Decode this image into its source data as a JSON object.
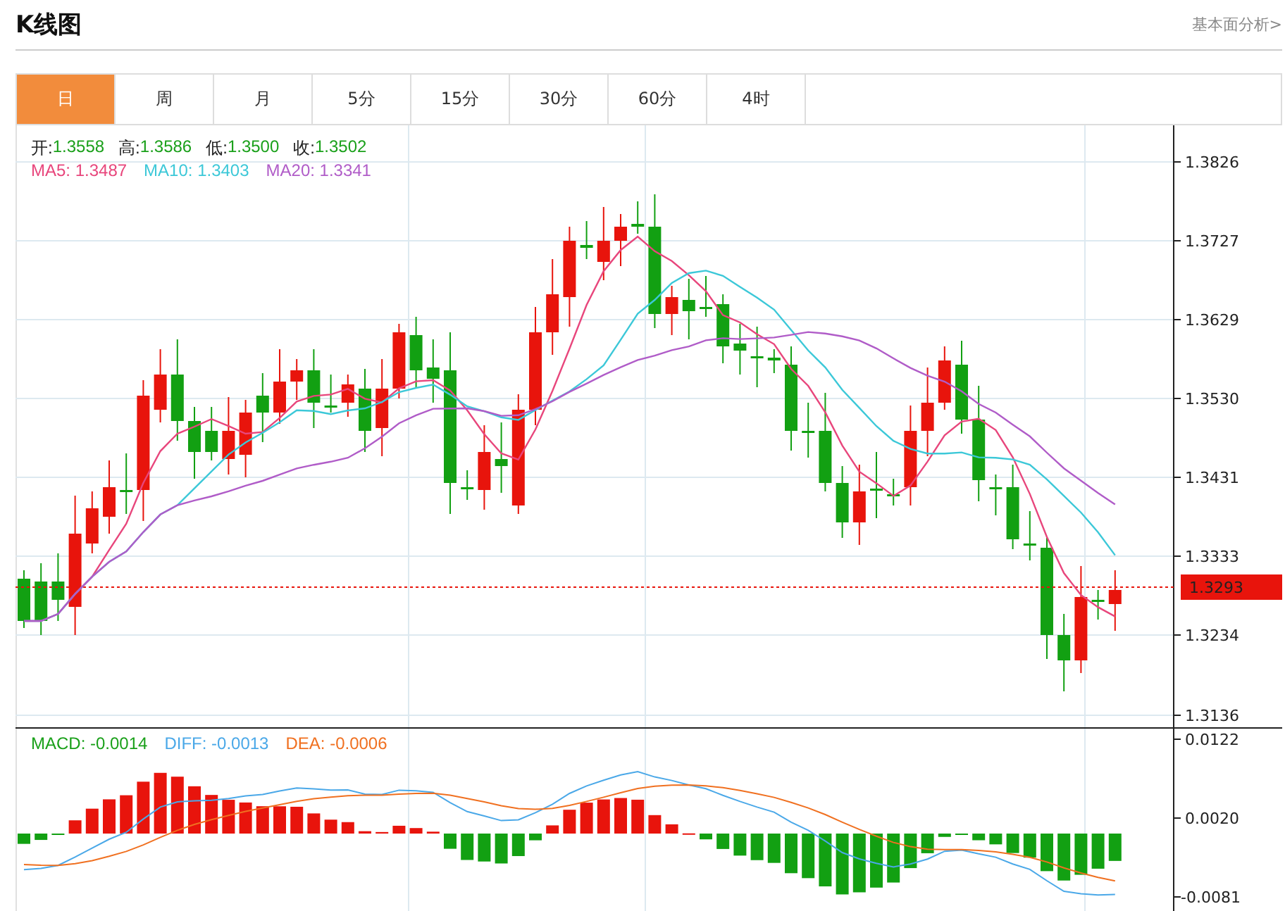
{
  "title": "K线图",
  "header_link": "基本面分析>",
  "tabs": [
    {
      "label": "日",
      "selected": true
    },
    {
      "label": "周",
      "selected": false
    },
    {
      "label": "月",
      "selected": false
    },
    {
      "label": "5分",
      "selected": false
    },
    {
      "label": "15分",
      "selected": false
    },
    {
      "label": "30分",
      "selected": false
    },
    {
      "label": "60分",
      "selected": false
    },
    {
      "label": "4时",
      "selected": false
    }
  ],
  "quote": [
    {
      "label": "开:",
      "value": "1.3558"
    },
    {
      "label": "高:",
      "value": "1.3586"
    },
    {
      "label": "低:",
      "value": "1.3500"
    },
    {
      "label": "收:",
      "value": "1.3502"
    }
  ],
  "moving_averages": [
    {
      "text": "MA5: 1.3487",
      "color": "#e8467c"
    },
    {
      "text": "MA10: 1.3403",
      "color": "#3cc8d8"
    },
    {
      "text": "MA20: 1.3341",
      "color": "#b05cc8"
    }
  ],
  "price_axis": [
    "1.3826",
    "1.3727",
    "1.3629",
    "1.3530",
    "1.3431",
    "1.3333",
    "1.3234",
    "1.3136"
  ],
  "current_price": "1.3293",
  "macd_legend": [
    {
      "text": "MACD: -0.0014",
      "color": "#1aa01a"
    },
    {
      "text": "DIFF: -0.0013",
      "color": "#4aa8e8"
    },
    {
      "text": "DEA: -0.0006",
      "color": "#f07020"
    }
  ],
  "macd_axis": [
    "0.0122",
    "0.0020",
    "-0.0081"
  ]
}
